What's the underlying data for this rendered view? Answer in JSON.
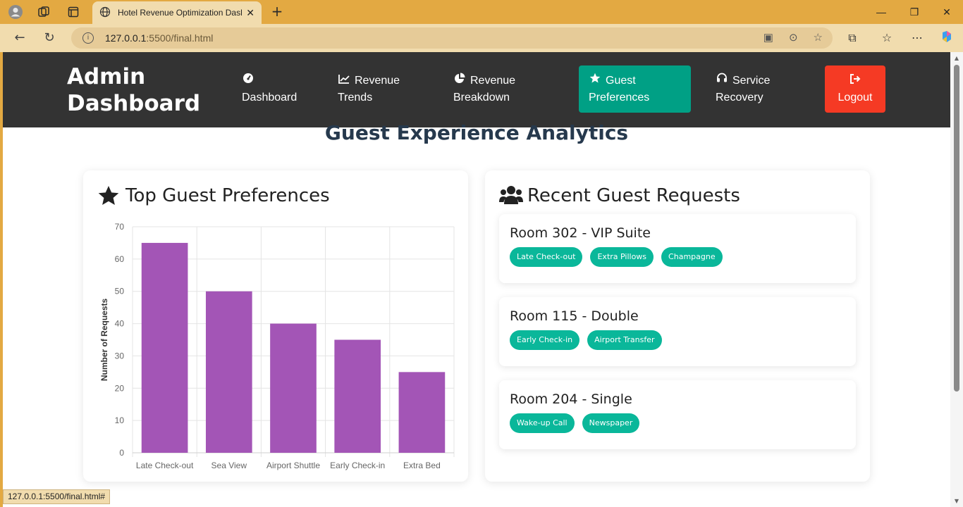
{
  "browser": {
    "tab_title": "Hotel Revenue Optimization Dash",
    "url_host": "127.0.0.1",
    "url_path": ":5500/final.html",
    "status_url": "127.0.0.1:5500/final.html#"
  },
  "header": {
    "brand": "Admin Dashboard",
    "nav": [
      {
        "label": "Dashboard",
        "icon": "gauge-icon"
      },
      {
        "label": "Revenue Trends",
        "icon": "line-chart-icon"
      },
      {
        "label": "Revenue Breakdown",
        "icon": "pie-chart-icon"
      },
      {
        "label": "Guest Preferences",
        "icon": "star-icon",
        "active": true
      },
      {
        "label": "Service Recovery",
        "icon": "headset-icon"
      },
      {
        "label": "Logout",
        "icon": "sign-out-icon"
      }
    ],
    "colors": {
      "bg": "#333333",
      "active": "#00a085",
      "logout": "#f53a24"
    }
  },
  "page": {
    "title": "Guest Experience Analytics"
  },
  "preferences": {
    "title": "Top Guest Preferences",
    "icon": "star-icon"
  },
  "chart_data": {
    "type": "bar",
    "categories": [
      "Late Check-out",
      "Sea View",
      "Airport Shuttle",
      "Early Check-in",
      "Extra Bed"
    ],
    "values": [
      65,
      50,
      40,
      35,
      25
    ],
    "title": "",
    "xlabel": "",
    "ylabel": "Number of Requests",
    "ylim": [
      0,
      70
    ],
    "yticks": [
      0,
      10,
      20,
      30,
      40,
      50,
      60,
      70
    ],
    "grid": true,
    "bar_color": "#a355b6"
  },
  "requests": {
    "title": "Recent Guest Requests",
    "icon": "users-icon",
    "items": [
      {
        "room": "Room 302 - VIP Suite",
        "tags": [
          "Late Check-out",
          "Extra Pillows",
          "Champagne"
        ]
      },
      {
        "room": "Room 115 - Double",
        "tags": [
          "Early Check-in",
          "Airport Transfer"
        ]
      },
      {
        "room": "Room 204 - Single",
        "tags": [
          "Wake-up Call",
          "Newspaper"
        ]
      }
    ]
  }
}
